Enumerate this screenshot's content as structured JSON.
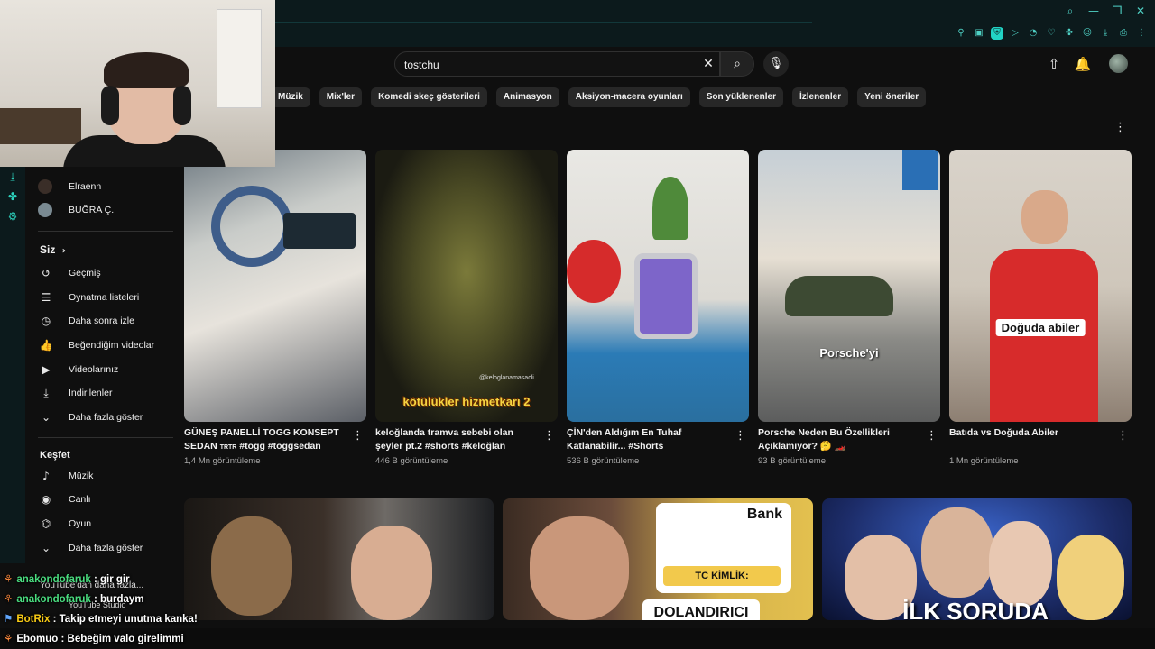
{
  "search": {
    "value": "tostchu"
  },
  "chips": [
    "Müzik",
    "Mix'ler",
    "Komedi skeç gösterileri",
    "Animasyon",
    "Aksiyon-macera oyunları",
    "Son yüklenenler",
    "İzlenenler",
    "Yeni öneriler"
  ],
  "sidebar": {
    "subscriptions": [
      {
        "name": "Elraenn",
        "avatar_color": "#3a2e28"
      },
      {
        "name": "BUĞRA Ç.",
        "avatar_color": "#7a8a92"
      }
    ],
    "you_heading": "Siz",
    "you_items": [
      {
        "label": "Geçmiş",
        "icon": "history-icon"
      },
      {
        "label": "Oynatma listeleri",
        "icon": "playlist-icon"
      },
      {
        "label": "Daha sonra izle",
        "icon": "watch-later-icon"
      },
      {
        "label": "Beğendiğim videolar",
        "icon": "like-icon"
      },
      {
        "label": "Videolarınız",
        "icon": "your-videos-icon"
      },
      {
        "label": "İndirilenler",
        "icon": "download-icon"
      },
      {
        "label": "Daha fazla göster",
        "icon": "chevron-down-icon"
      }
    ],
    "explore_heading": "Keşfet",
    "explore_items": [
      {
        "label": "Müzik",
        "icon": "music-icon"
      },
      {
        "label": "Canlı",
        "icon": "live-icon"
      },
      {
        "label": "Oyun",
        "icon": "gaming-icon"
      },
      {
        "label": "Daha fazla göster",
        "icon": "chevron-down-icon"
      }
    ],
    "more_from_youtube": "YouTube'dan daha fazla...",
    "youtube_studio": "YouTube Studio"
  },
  "shorts": [
    {
      "title": "GÜNEŞ PANELLİ TOGG KONSEPT SEDAN",
      "title_suffix": "TRTR",
      "title_tags": " #togg #toggsedan",
      "views": "1,4 Mn görüntüleme",
      "overlay": ""
    },
    {
      "title": "keloğlanda tramva sebebi olan şeyler pt.2 #shorts #keloğlan",
      "views": "446 B görüntüleme",
      "overlay": "kötülükler hizmetkarı 2",
      "watermark": "@keloglanamasacli"
    },
    {
      "title": "ÇİN'den Aldığım En Tuhaf Katlanabilir... #Shorts",
      "views": "536 B görüntüleme",
      "overlay": ""
    },
    {
      "title": "Porsche Neden Bu Özellikleri Açıklamıyor? 🤔 🏎️",
      "views": "93 B görüntüleme",
      "overlay": "Porsche'yi"
    },
    {
      "title": "Batıda vs Doğuda Abiler",
      "views": "1 Mn görüntüleme",
      "overlay": "Doğuda abiler"
    }
  ],
  "videos": [
    {
      "overlay": ""
    },
    {
      "overlay": "DOLANDIRICI",
      "card_bank": "Bank",
      "card_label": "TC KİMLİK:"
    },
    {
      "overlay": "İLK SORUDA"
    }
  ],
  "chat": [
    {
      "user": "anakondofaruk",
      "message": "gir gir",
      "color": "#4ade80"
    },
    {
      "user": "anakondofaruk",
      "message": "burdaym",
      "color": "#4ade80"
    },
    {
      "user": "BotRix",
      "message": "Takip etmeyi unutma kanka!",
      "color": "#facc15"
    },
    {
      "user": "Ebomuo",
      "message": "Bebeğim valo girelimmi",
      "color": "#ffffff"
    }
  ],
  "colors": {
    "accent": "#22d3c5",
    "bg": "#0f0f0f",
    "chip": "#272727"
  }
}
